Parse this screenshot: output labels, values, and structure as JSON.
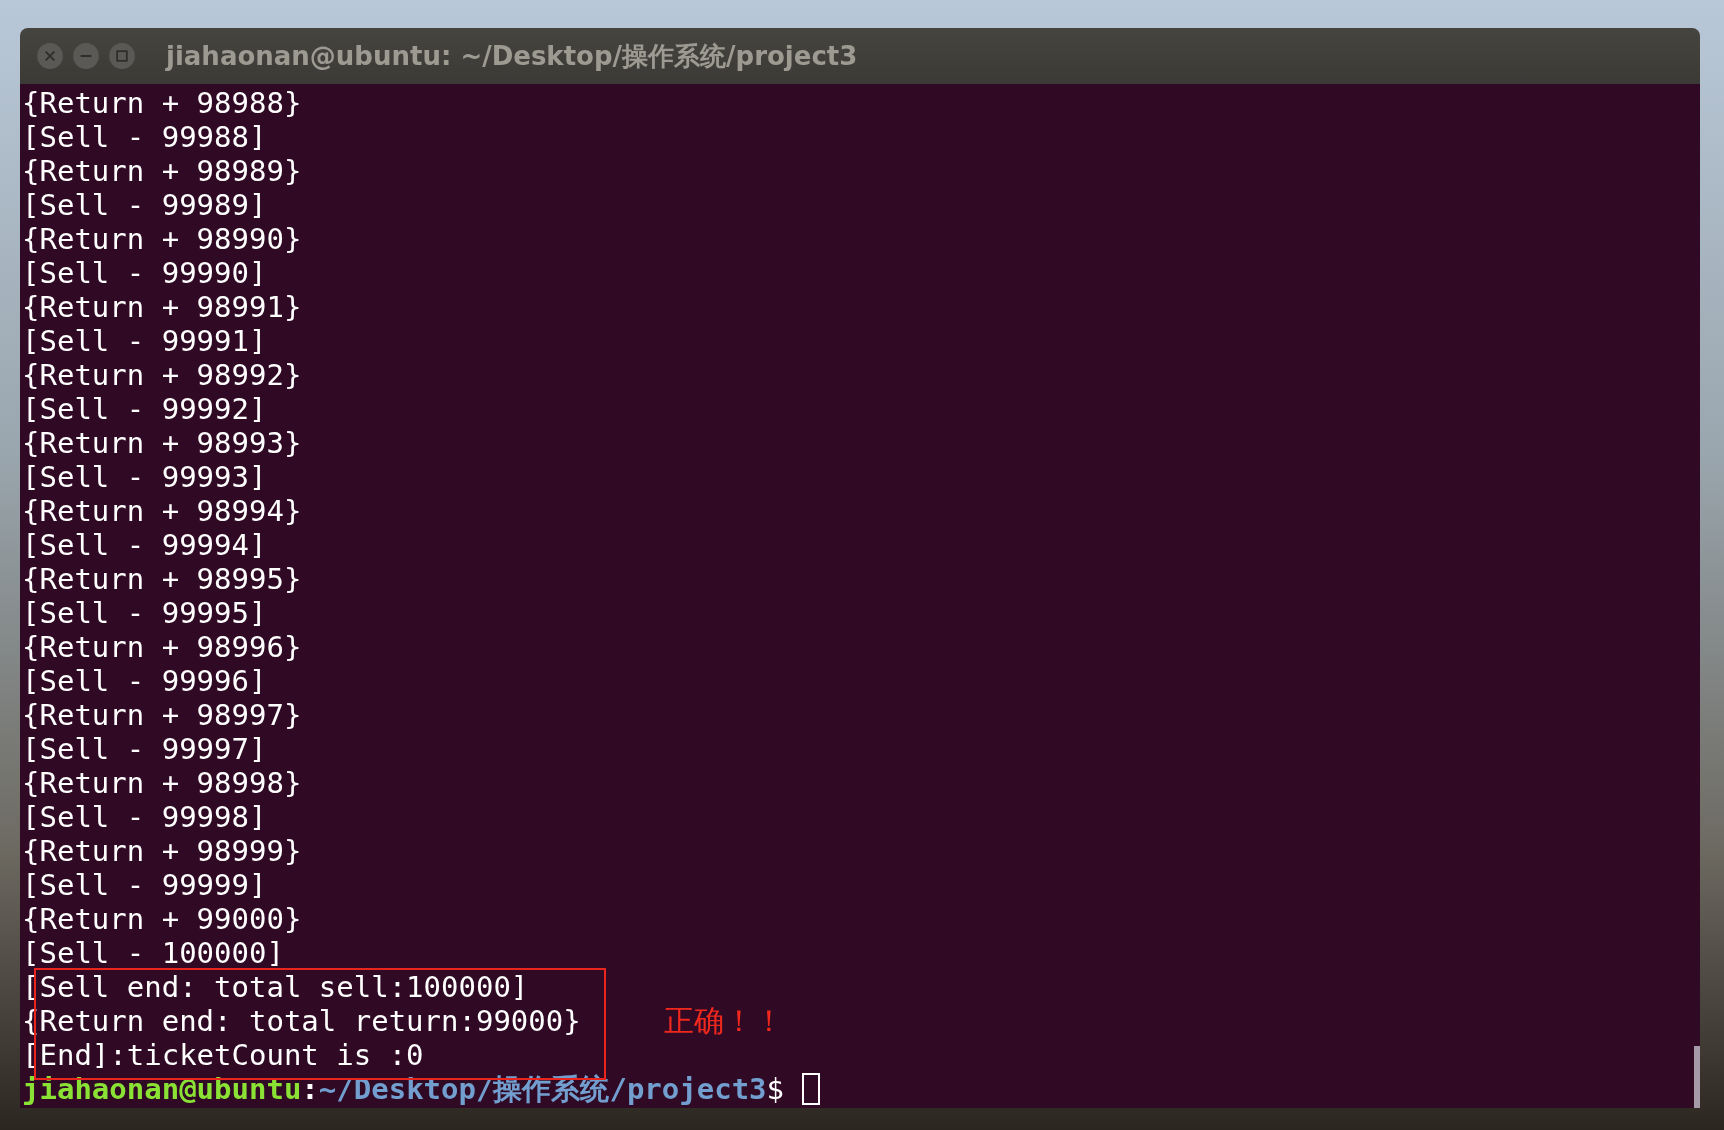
{
  "window": {
    "title": "jiahaonan@ubuntu: ~/Desktop/操作系统/project3"
  },
  "lines": [
    {
      "text": "{Return + 98988}",
      "boxed": false
    },
    {
      "text": "[Sell - 99988]",
      "boxed": false
    },
    {
      "text": "{Return + 98989}",
      "boxed": false
    },
    {
      "text": "[Sell - 99989]",
      "boxed": false
    },
    {
      "text": "{Return + 98990}",
      "boxed": false
    },
    {
      "text": "[Sell - 99990]",
      "boxed": false
    },
    {
      "text": "{Return + 98991}",
      "boxed": false
    },
    {
      "text": "[Sell - 99991]",
      "boxed": false
    },
    {
      "text": "{Return + 98992}",
      "boxed": false
    },
    {
      "text": "[Sell - 99992]",
      "boxed": false
    },
    {
      "text": "{Return + 98993}",
      "boxed": false
    },
    {
      "text": "[Sell - 99993]",
      "boxed": false
    },
    {
      "text": "{Return + 98994}",
      "boxed": false
    },
    {
      "text": "[Sell - 99994]",
      "boxed": false
    },
    {
      "text": "{Return + 98995}",
      "boxed": false
    },
    {
      "text": "[Sell - 99995]",
      "boxed": false
    },
    {
      "text": "{Return + 98996}",
      "boxed": false
    },
    {
      "text": "[Sell - 99996]",
      "boxed": false
    },
    {
      "text": "{Return + 98997}",
      "boxed": false
    },
    {
      "text": "[Sell - 99997]",
      "boxed": false
    },
    {
      "text": "{Return + 98998}",
      "boxed": false
    },
    {
      "text": "[Sell - 99998]",
      "boxed": false
    },
    {
      "text": "{Return + 98999}",
      "boxed": false
    },
    {
      "text": "[Sell - 99999]",
      "boxed": false
    },
    {
      "text": "{Return + 99000}",
      "boxed": false
    },
    {
      "text": "[Sell - 100000]",
      "boxed": false
    },
    {
      "text": "[Sell end: total sell:100000]",
      "boxed": true
    },
    {
      "text": "{Return end: total return:99000}",
      "boxed": true
    },
    {
      "text": "[End]:ticketCount is :0",
      "boxed": true
    }
  ],
  "annotation": {
    "text": "正确！！"
  },
  "prompt": {
    "user_host": "jiahaonan@ubuntu",
    "separator": ":",
    "path": "~/Desktop/操作系统/project3",
    "symbol": "$"
  }
}
